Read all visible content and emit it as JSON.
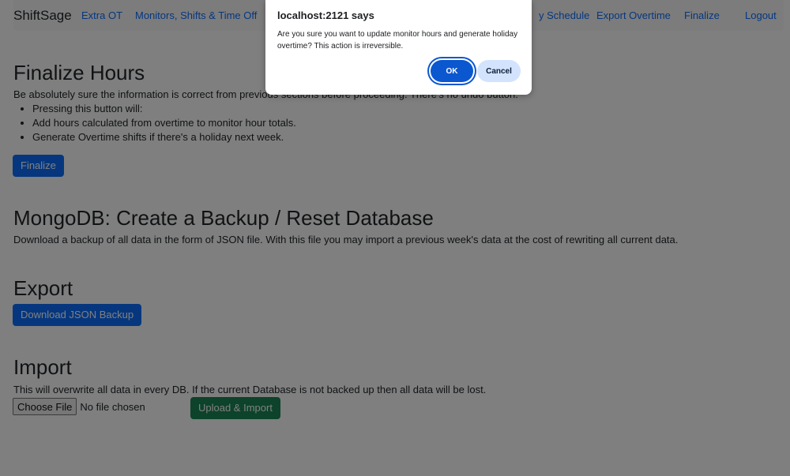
{
  "nav": {
    "brand": "ShiftSage",
    "links": [
      "Extra OT",
      "Monitors, Shifts & Time Off",
      "y Schedule",
      "Export Overtime",
      "Finalize",
      "Logout"
    ]
  },
  "finalize": {
    "heading": "Finalize Hours",
    "intro": "Be absolutely sure the information is correct from previous sections before proceeding. There's no undo button.",
    "items": [
      "Pressing this button will:",
      "Add hours calculated from overtime to monitor hour totals.",
      "Generate Overtime shifts if there's a holiday next week."
    ],
    "button": "Finalize"
  },
  "mongo": {
    "heading": "MongoDB: Create a Backup / Reset Database",
    "text": "Download a backup of all data in the form of JSON file. With this file you may import a previous week's data at the cost of rewriting all current data."
  },
  "export": {
    "heading": "Export",
    "button": "Download JSON Backup"
  },
  "import": {
    "heading": "Import",
    "text": "This will overwrite all data in every DB. If the current Database is not backed up then all data will be lost.",
    "choose_file": "Choose File",
    "no_file": "No file chosen",
    "button": "Upload & Import"
  },
  "dialog": {
    "title": "localhost:2121 says",
    "message": "Are you sure you want to update monitor hours and generate holiday overtime? This action is irreversible.",
    "ok": "OK",
    "cancel": "Cancel"
  },
  "colors": {
    "primary": "#0d6efd",
    "success": "#198754",
    "dialog_ok": "#0b57d0",
    "dialog_cancel": "#d3e3fd"
  }
}
